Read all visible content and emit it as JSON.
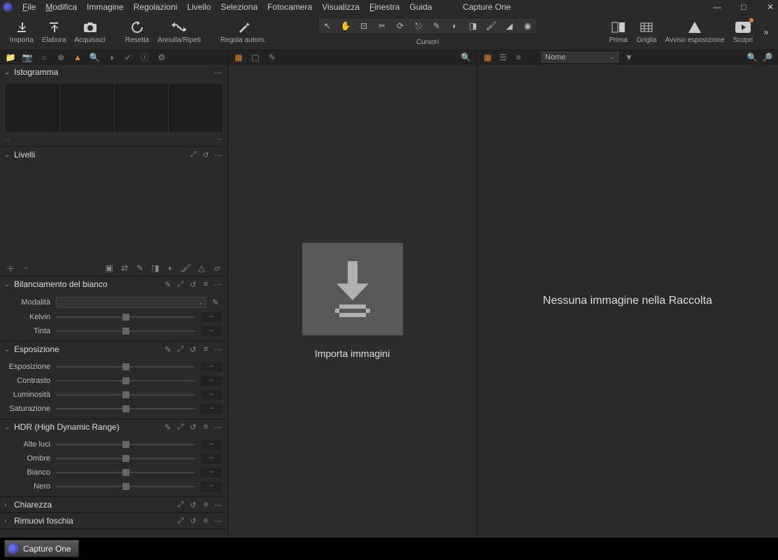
{
  "app": {
    "title": "Capture One"
  },
  "menu": {
    "file": "File",
    "edit": "Modifica",
    "image": "Immagine",
    "adjustments": "Regolazioni",
    "layer": "Livello",
    "select": "Seleziona",
    "camera": "Fotocamera",
    "view": "Visualizza",
    "window": "Finestra",
    "help": "Guida"
  },
  "toolbar": {
    "import": "Importa",
    "process": "Elabora",
    "capture": "Acquisisci",
    "reset": "Resetta",
    "undo": "Annulla/Ripeti",
    "auto": "Regola autom.",
    "cursors_label": "Cursori",
    "before": "Prima",
    "grid": "Griglia",
    "exposure_warning": "Avviso esposizione",
    "discover": "Scopri"
  },
  "panel": {
    "histogram": {
      "title": "Istogramma",
      "left": "--",
      "right": "--"
    },
    "levels": {
      "title": "Livelli"
    },
    "white_balance": {
      "title": "Bilanciamento del bianco",
      "mode": "Modalità",
      "kelvin": "Kelvin",
      "tint": "Tinta"
    },
    "exposure": {
      "title": "Esposizione",
      "exposure": "Esposizione",
      "contrast": "Contrasto",
      "brightness": "Luminosità",
      "saturation": "Saturazione"
    },
    "hdr": {
      "title": "HDR (High Dynamic Range)",
      "highlights": "Alte luci",
      "shadows": "Ombre",
      "whites": "Bianco",
      "blacks": "Nero"
    },
    "clarity": {
      "title": "Chiarezza"
    },
    "dehaze": {
      "title": "Rimuovi foschia"
    },
    "value_placeholder": "--"
  },
  "viewer": {
    "import_label": "Importa immagini"
  },
  "browser": {
    "sort_by": "Nome",
    "empty": "Nessuna immagine nella Raccolta"
  },
  "taskbar": {
    "app": "Capture One"
  }
}
